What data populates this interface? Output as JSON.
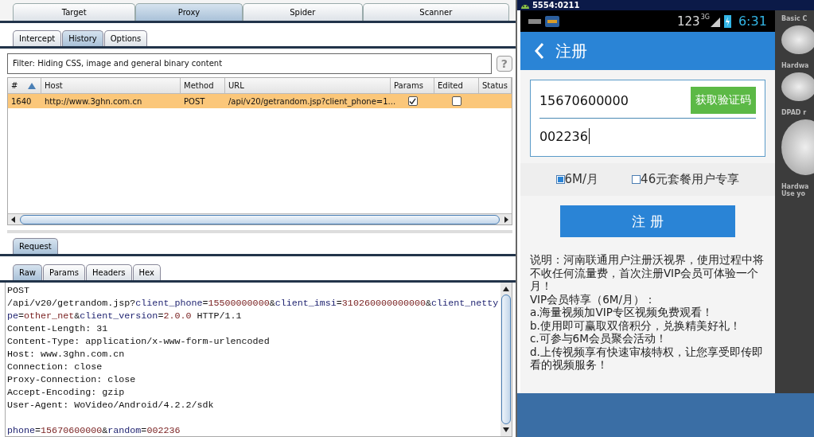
{
  "burp": {
    "main_tabs": [
      {
        "label": "Target",
        "selected": false
      },
      {
        "label": "Proxy",
        "selected": true
      },
      {
        "label": "Spider",
        "selected": false
      },
      {
        "label": "Scanner",
        "selected": false
      }
    ],
    "proxy_tabs": [
      {
        "label": "Intercept",
        "selected": false
      },
      {
        "label": "History",
        "selected": true
      },
      {
        "label": "Options",
        "selected": false
      }
    ],
    "filter": "Filter: Hiding CSS, image and general binary content",
    "help_button": "?",
    "table": {
      "columns": [
        "#",
        "Host",
        "Method",
        "URL",
        "Params",
        "Edited",
        "Status"
      ],
      "rows": [
        {
          "number": "1640",
          "host": "http://www.3ghn.com.cn",
          "method": "POST",
          "url": "/api/v20/getrandom.jsp?client_phone=1...",
          "params": true,
          "edited": false,
          "selected": true
        }
      ]
    },
    "request_tab": "Request",
    "view_tabs": [
      {
        "label": "Raw",
        "selected": true
      },
      {
        "label": "Params",
        "selected": false
      },
      {
        "label": "Headers",
        "selected": false
      },
      {
        "label": "Hex",
        "selected": false
      }
    ],
    "raw_lines": [
      [
        {
          "kind": "plain",
          "text": "POST"
        }
      ],
      [
        {
          "kind": "plain",
          "text": "/api/v20/getrandom.jsp?"
        },
        {
          "kind": "name",
          "text": "client_phone"
        },
        {
          "kind": "plain",
          "text": "="
        },
        {
          "kind": "value",
          "text": "15500000000"
        },
        {
          "kind": "plain",
          "text": "&"
        },
        {
          "kind": "name",
          "text": "client_imsi"
        },
        {
          "kind": "plain",
          "text": "="
        },
        {
          "kind": "value",
          "text": "310260000000000"
        },
        {
          "kind": "plain",
          "text": "&"
        },
        {
          "kind": "name",
          "text": "client_nettype"
        },
        {
          "kind": "plain",
          "text": "="
        },
        {
          "kind": "value",
          "text": "other_net"
        },
        {
          "kind": "plain",
          "text": "&"
        },
        {
          "kind": "name",
          "text": "client_version"
        },
        {
          "kind": "plain",
          "text": "="
        },
        {
          "kind": "value",
          "text": "2.0.0"
        },
        {
          "kind": "plain",
          "text": " HTTP/1.1"
        }
      ],
      [
        {
          "kind": "plain",
          "text": "Content-Length: 31"
        }
      ],
      [
        {
          "kind": "plain",
          "text": "Content-Type: application/x-www-form-urlencoded"
        }
      ],
      [
        {
          "kind": "plain",
          "text": "Host: www.3ghn.com.cn"
        }
      ],
      [
        {
          "kind": "plain",
          "text": "Connection: close"
        }
      ],
      [
        {
          "kind": "plain",
          "text": "Proxy-Connection: close"
        }
      ],
      [
        {
          "kind": "plain",
          "text": "Accept-Encoding: gzip"
        }
      ],
      [
        {
          "kind": "plain",
          "text": "User-Agent: WoVideo/Android/4.2.2/sdk"
        }
      ]
    ],
    "raw_body": [
      {
        "kind": "name",
        "text": "phone"
      },
      {
        "kind": "plain",
        "text": "="
      },
      {
        "kind": "value",
        "text": "15670600000"
      },
      {
        "kind": "plain",
        "text": "&"
      },
      {
        "kind": "name",
        "text": "random"
      },
      {
        "kind": "plain",
        "text": "="
      },
      {
        "kind": "value",
        "text": "002236"
      }
    ]
  },
  "emulator": {
    "title": "5554:0211",
    "status_bar": {
      "signal_text": "123",
      "network": "3G",
      "time": "6:31"
    },
    "app": {
      "title": "注册",
      "phone": "15670600000",
      "code_button": "获取验证码",
      "code": "002236",
      "options": [
        {
          "label": "6M/月",
          "checked": true
        },
        {
          "label": "46元套餐用户专享",
          "checked": false
        }
      ],
      "register_button": "注 册",
      "description": [
        "说明：河南联通用户注册沃视界，使用过程中将不收任何流量费，首次注册VIP会员可体验一个月！",
        "VIP会员特享（6M/月）：",
        "a.海量视频加VIP专区视频免费观看！",
        "b.使用即可赢取双倍积分，兑换精美好礼！",
        "c.可参与6M会员聚会活动！",
        "d.上传视频享有快速审核特权，让您享受即传即看的视频服务！"
      ]
    },
    "side_labels": [
      "Basic C",
      "Hardwa",
      "DPAD r",
      "Hardwa",
      "Use yo"
    ]
  }
}
